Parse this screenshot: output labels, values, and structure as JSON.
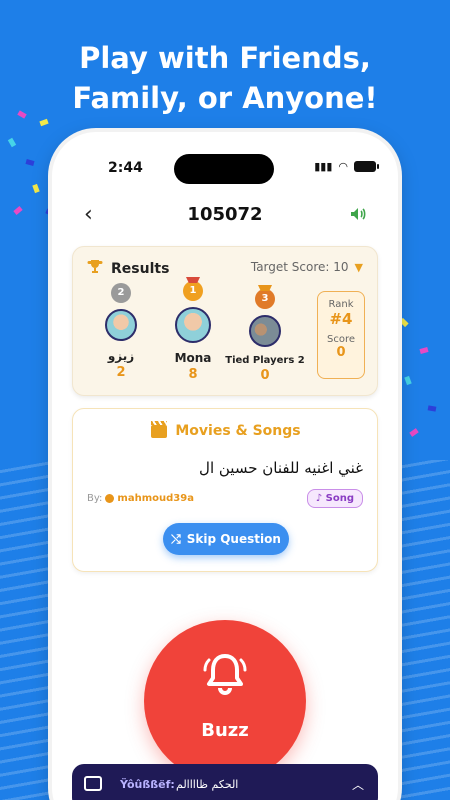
{
  "headline": {
    "line1": "Play with Friends,",
    "line2": "Family, or Anyone!"
  },
  "status_bar": {
    "time": "2:44"
  },
  "header": {
    "room_code": "105072",
    "back_icon": "chevron-left-icon",
    "sound_icon": "speaker-icon"
  },
  "results": {
    "title": "Results",
    "target_label": "Target Score: 10",
    "players": [
      {
        "place": "2",
        "name": "زيزو",
        "score": "2"
      },
      {
        "place": "1",
        "name": "Mona",
        "score": "8"
      },
      {
        "place": "3",
        "name": "Tied Players 2",
        "score": "0"
      }
    ],
    "rank_label": "Rank",
    "rank_value": "#4",
    "score_label": "Score",
    "score_value": "0"
  },
  "question": {
    "category": "Movies & Songs",
    "text": "غني اغنيه للفنان حسين ال",
    "by_label": "By:",
    "author": "mahmoud39a",
    "tag": "Song",
    "skip_label": "Skip Question"
  },
  "buzz": {
    "label": "Buzz"
  },
  "chat": {
    "name": "Ÿôûßßëf:",
    "message": "الحكم ظاااالم"
  },
  "colors": {
    "background": "#1e7fe8",
    "accent": "#e8951a",
    "buzz": "#f0433a",
    "skip": "#3b8ff0",
    "chat": "#1f1a56"
  }
}
